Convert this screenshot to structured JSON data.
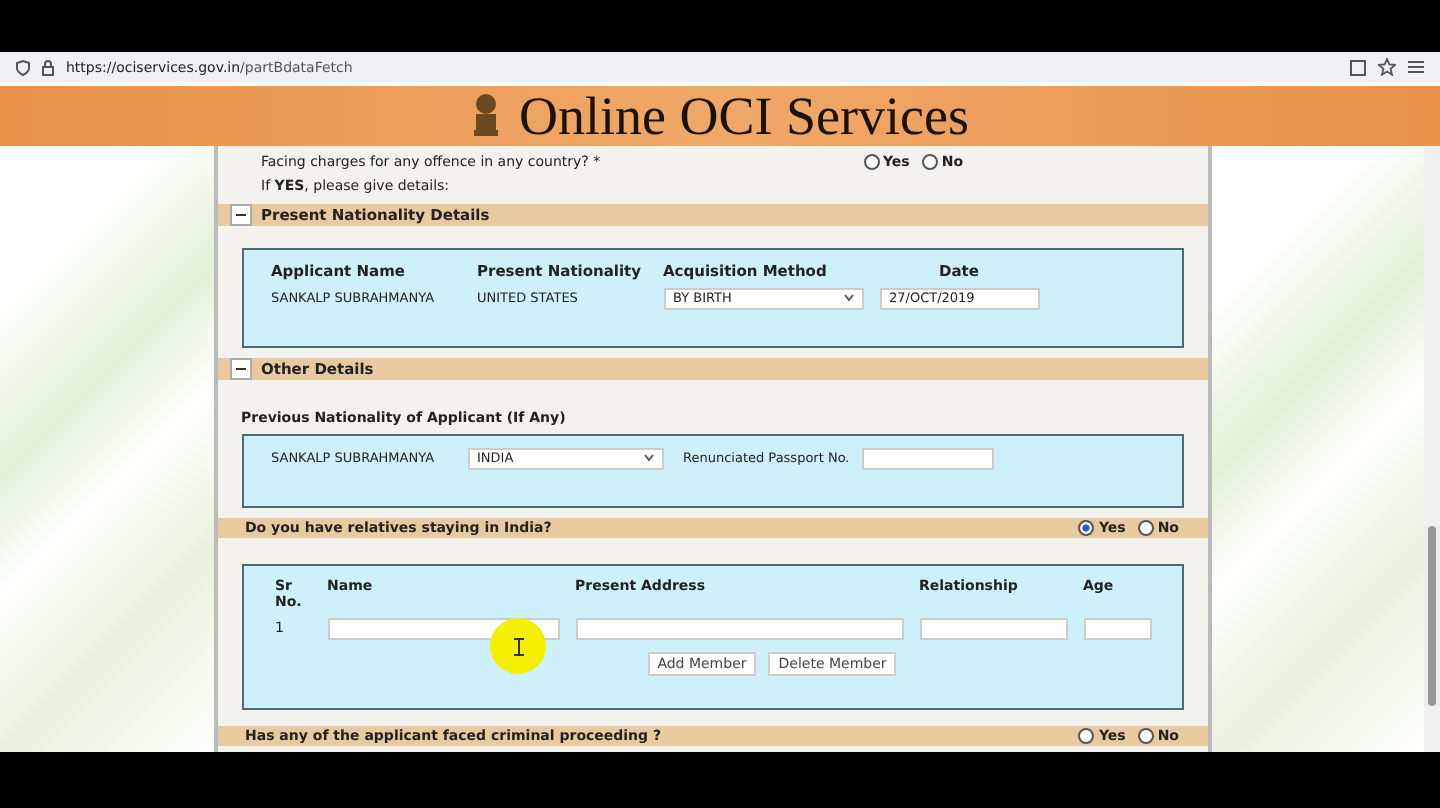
{
  "browser": {
    "url_host": "https://ociservices.gov.in",
    "url_path": "/partBdataFetch"
  },
  "header": {
    "title": "Online OCI Services"
  },
  "charges": {
    "question": "Facing charges for any offence in any country? *",
    "options": [
      {
        "label": "Yes",
        "selected": false
      },
      {
        "label": "No",
        "selected": false
      }
    ],
    "details": "If **YES**, please give details:"
  },
  "present_nationality": {
    "title": "Present Nationality Details",
    "expanded": true,
    "columns": [
      "Applicant Name",
      "Present Nationality",
      "Acquisition Method",
      "Date"
    ],
    "name": "SANKALP SUBRAHMANYA",
    "nationality": "UNITED STATES",
    "method": "BY BIRTH",
    "date": "27/OCT/2019"
  },
  "other_details": {
    "title": "Other Details",
    "expanded": true,
    "label": "Previous Nationality of Applicant (If Any)",
    "name": "SANKALP SUBRAHMANYA",
    "country": "INDIA",
    "passport_label": "Renunciated Passport No."
  },
  "relatives": {
    "question": "Do you have relatives staying in India?",
    "options": [
      {
        "label": "Yes",
        "selected": true
      },
      {
        "label": "No",
        "selected": false
      }
    ],
    "columns": [
      "Sr No.",
      "Name",
      "Present Address",
      "Relationship",
      "Age"
    ],
    "rows": [
      {
        "sr": "1"
      }
    ],
    "buttons": [
      "Add Member",
      "Delete Member"
    ]
  },
  "criminal": {
    "question": "Has any of the applicant faced criminal proceeding ?",
    "options": [
      {
        "label": "Yes",
        "selected": false
      },
      {
        "label": "No",
        "selected": false
      }
    ]
  }
}
